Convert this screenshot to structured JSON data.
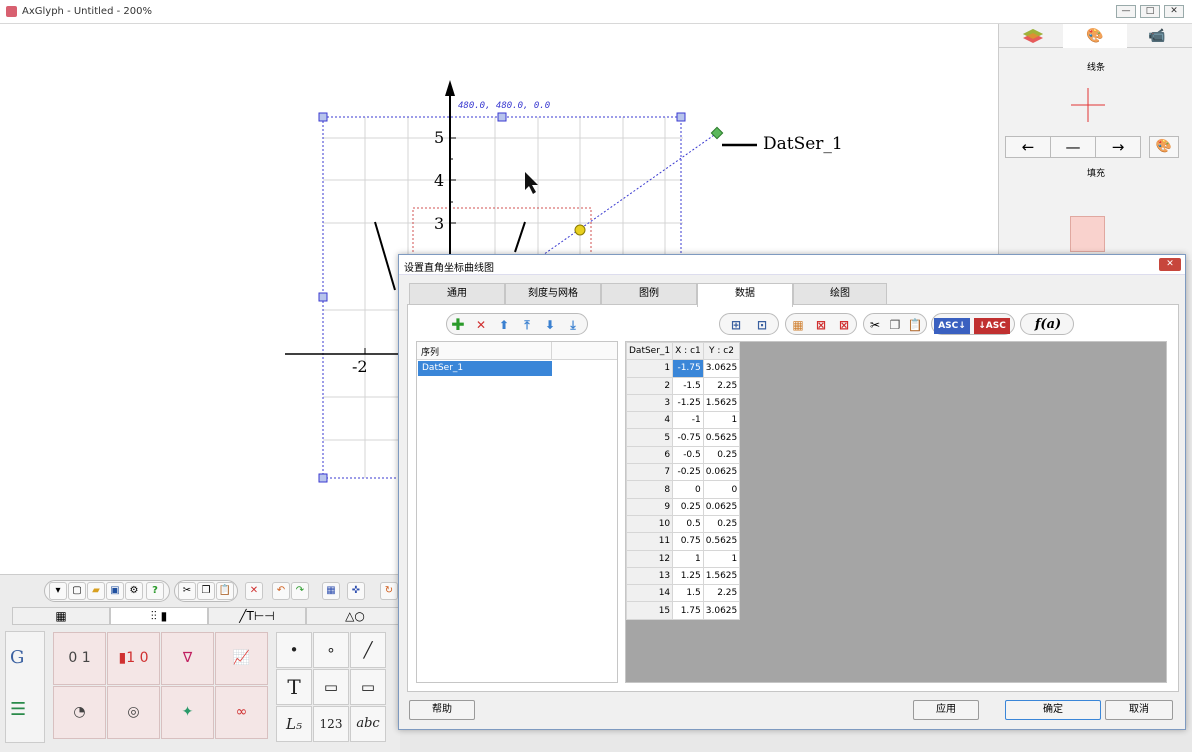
{
  "app": {
    "title": "AxGlyph - Untitled - 200%",
    "min": "—",
    "max": "□",
    "close": "✕"
  },
  "canvas": {
    "coord_readout": "480.0, 480.0, 0.0",
    "y_ticks": [
      "5",
      "4",
      "3"
    ],
    "x_ticks": [
      "-2"
    ],
    "legend_label": "DatSer_1"
  },
  "right_panel": {
    "tabs": [
      "layers-icon",
      "palette-icon",
      "camera-icon"
    ],
    "line_label": "线条",
    "fill_label": "填充",
    "arrow_left": "←",
    "arrow_none": "—",
    "arrow_right": "→",
    "fill_color": "#f9d2cd",
    "line_color": "#e23434"
  },
  "bottom_panel": {
    "tabs": [
      "▦",
      "⫶⫶ ▮",
      "╱T⊢⊣",
      "△○"
    ],
    "cells": [
      "0 1",
      "▮1 0",
      "∇",
      "📈",
      "◔",
      "◎",
      "✦",
      "∞"
    ],
    "symbols": [
      "•",
      "∘",
      "╱",
      "T",
      "▭",
      "▭",
      "L₅",
      "123",
      "abc"
    ]
  },
  "dialog": {
    "title": "设置直角坐标曲线图",
    "close": "✕",
    "tabs": [
      "通用",
      "刻度与网格",
      "图例",
      "数据",
      "绘图"
    ],
    "active_tab": "数据",
    "series_list": {
      "header": "序列",
      "items": [
        "DatSer_1"
      ]
    },
    "grid": {
      "headers": [
        "DatSer_1",
        "X : c1",
        "Y : c2"
      ],
      "rows": [
        [
          "1",
          "-1.75",
          "3.0625"
        ],
        [
          "2",
          "-1.5",
          "2.25"
        ],
        [
          "3",
          "-1.25",
          "1.5625"
        ],
        [
          "4",
          "-1",
          "1"
        ],
        [
          "5",
          "-0.75",
          "0.5625"
        ],
        [
          "6",
          "-0.5",
          "0.25"
        ],
        [
          "7",
          "-0.25",
          "0.0625"
        ],
        [
          "8",
          "0",
          "0"
        ],
        [
          "9",
          "0.25",
          "0.0625"
        ],
        [
          "10",
          "0.5",
          "0.25"
        ],
        [
          "11",
          "0.75",
          "0.5625"
        ],
        [
          "12",
          "1",
          "1"
        ],
        [
          "13",
          "1.25",
          "1.5625"
        ],
        [
          "14",
          "1.5",
          "2.25"
        ],
        [
          "15",
          "1.75",
          "3.0625"
        ]
      ]
    },
    "toolbar_func": "f(a)",
    "buttons": {
      "help": "帮助",
      "apply": "应用",
      "ok": "确定",
      "cancel": "取消"
    }
  }
}
